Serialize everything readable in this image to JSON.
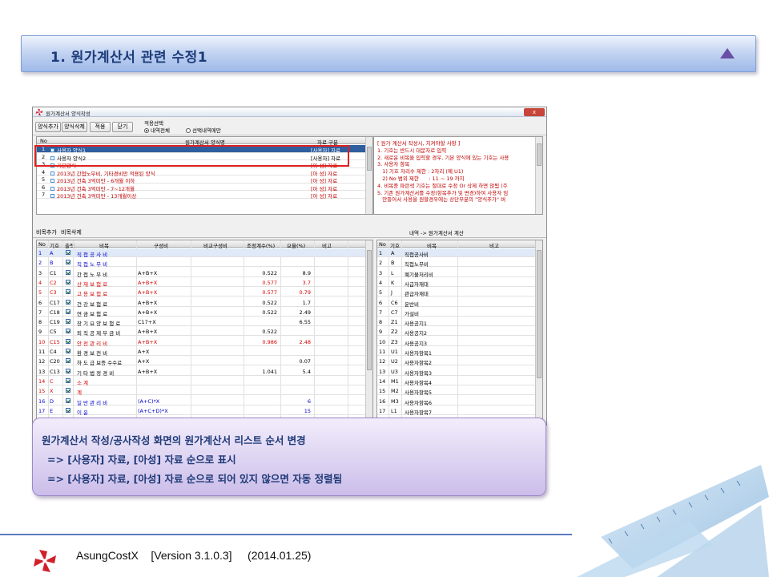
{
  "slide": {
    "title": "1. 원가계산서 관련 수정1",
    "callout": {
      "line1": "원가계산서 작성/공사작성 화면의 원가계산서 리스트 순서 변경",
      "line2": "=> [사용자] 자료, [아성] 자료 순으로 표시",
      "line3": "=> [사용자] 자료, [아성] 자료 순으로 되어 있지 않으면 자동 정렬됨"
    },
    "footer": {
      "product": "AsungCostX",
      "version": "[Version 3.1.0.3]",
      "date": "(2014.01.25)"
    }
  },
  "window": {
    "title": "원가계산서 양식작성",
    "close": "x"
  },
  "toolbar": {
    "add_form": "양식추가",
    "delete_form": "양식삭제",
    "apply": "적용",
    "close": "닫기",
    "apply_option_title": "적용선택",
    "radio_all": "내역전체",
    "radio_selected": "선택내역에만"
  },
  "form_grid": {
    "headers": {
      "no": "No",
      "name": "원가계산서 양식명",
      "kind": "자료 구분"
    },
    "rows": [
      {
        "no": "1",
        "name": "사용자 양식1",
        "kind": "[사용자] 자료"
      },
      {
        "no": "2",
        "name": "사용자 양식2",
        "kind": "[사용자] 자료"
      },
      {
        "no": "3",
        "name": "기본양식",
        "kind": "[아 성] 자료"
      },
      {
        "no": "4",
        "name": "2013년 간접노무비, 기타경비만 적용된 양식",
        "kind": "[아 성] 자료"
      },
      {
        "no": "5",
        "name": "2013년 건축 3억미만 - 6개월 이하",
        "kind": "[아 성] 자료"
      },
      {
        "no": "6",
        "name": "2013년 건축 3억미만 - 7~12개월",
        "kind": "[아 성] 자료"
      },
      {
        "no": "7",
        "name": "2013년 건축 3억미만 - 13개월이상",
        "kind": "[아 성] 자료"
      }
    ]
  },
  "notes": [
    "[ 원가 계산서 작성시, 지켜야할 사항 ]",
    "1. 기호는 반드시 대문자로 입력",
    "2. 새로운 비목을 입력할 경우, 기본 양식에 있는 기호는 사용",
    "3. 사용자 항목",
    "   1) 기호 자리수 제한 : 2자리 (예 U1)",
    "   2) No 범위 제한      : 11 ~ 19 까지",
    "4. 비목중 파란색 기호는 절대로 수정 Or 삭제 하면 않됨 (주",
    "5. 기존 원가계산서를 수정(항목추가 및 변경)하여 사용자 임",
    "   만들어서 사용을 원할경우에는 상단부분의 \"양식추가\" 버"
  ],
  "sub_toolbar": {
    "add_item": "비목추가",
    "delete_item": "비목삭제",
    "calc_caption": "내역 -> 원가계산서 계산"
  },
  "item_grid": {
    "headers": {
      "no": "No",
      "code": "기호",
      "print": "출력",
      "item": "비목",
      "composition": "구성비",
      "compare": "비교구성비",
      "adjust": "조정계수(%)",
      "rate": "요율(%)",
      "note": "비고"
    },
    "rows": [
      {
        "no": "1",
        "code": "A",
        "item": "직 접 공 사 비",
        "composition": "",
        "adjust": "",
        "rate": "",
        "color": "blue"
      },
      {
        "no": "2",
        "code": "B",
        "item": "직 접 노 무 비",
        "composition": "",
        "adjust": "",
        "rate": "",
        "color": "blue"
      },
      {
        "no": "3",
        "code": "C1",
        "item": "간 접 노 무 비",
        "composition": "A+B+X",
        "adjust": "0.522",
        "rate": "8.9",
        "color": "black"
      },
      {
        "no": "4",
        "code": "C2",
        "item": "산 재 보 험 료",
        "composition": "A+B+X",
        "adjust": "0.577",
        "rate": "3.7",
        "color": "red"
      },
      {
        "no": "5",
        "code": "C3",
        "item": "고 용 보 험 료",
        "composition": "A+B+X",
        "adjust": "0.577",
        "rate": "0.79",
        "color": "red"
      },
      {
        "no": "6",
        "code": "C17",
        "item": "건 강 보 험 료",
        "composition": "A+B+X",
        "adjust": "0.522",
        "rate": "1.7",
        "color": "black"
      },
      {
        "no": "7",
        "code": "C18",
        "item": "연 금 보 험 료",
        "composition": "A+B+X",
        "adjust": "0.522",
        "rate": "2.49",
        "color": "black"
      },
      {
        "no": "8",
        "code": "C19",
        "item": "장 기 요 양 보 험 료",
        "composition": "C17+X",
        "adjust": "",
        "rate": "6.55",
        "color": "black"
      },
      {
        "no": "9",
        "code": "C5",
        "item": "퇴 직 공 제 부 금 비",
        "composition": "A+B+X",
        "adjust": "0.522",
        "rate": "",
        "color": "black"
      },
      {
        "no": "10",
        "code": "C15",
        "item": "안 전 관 리 비",
        "composition": "A+B+X",
        "adjust": "0.986",
        "rate": "2.48",
        "color": "red"
      },
      {
        "no": "11",
        "code": "C4",
        "item": "환 경 보 전 비",
        "composition": "A+X",
        "adjust": "",
        "rate": "",
        "color": "black"
      },
      {
        "no": "12",
        "code": "C20",
        "item": "하 도 급 보증 수수료",
        "composition": "A+X",
        "adjust": "",
        "rate": "0.07",
        "color": "black"
      },
      {
        "no": "13",
        "code": "C13",
        "item": "기 타 법 정 경 비",
        "composition": "A+B+X",
        "adjust": "1.041",
        "rate": "5.4",
        "color": "black"
      },
      {
        "no": "14",
        "code": "C",
        "item": "소                계",
        "composition": "",
        "adjust": "",
        "rate": "",
        "color": "red"
      },
      {
        "no": "15",
        "code": "X",
        "item": "계",
        "composition": "",
        "adjust": "",
        "rate": "",
        "color": "red"
      },
      {
        "no": "16",
        "code": "D",
        "item": "일 반 관 리 비",
        "composition": "(A+C)*X",
        "adjust": "",
        "rate": "6",
        "color": "blue"
      },
      {
        "no": "17",
        "code": "E",
        "item": "이                윤",
        "composition": "(A+C+D)*X",
        "adjust": "",
        "rate": "15",
        "color": "blue"
      }
    ]
  },
  "calc_grid": {
    "headers": {
      "no": "No",
      "code": "기호",
      "item": "비목",
      "note": "비고"
    },
    "rows": [
      {
        "no": "1",
        "code": "A",
        "item": "직접공사비"
      },
      {
        "no": "2",
        "code": "B",
        "item": "직접노무비"
      },
      {
        "no": "3",
        "code": "L",
        "item": "폐기물처리비"
      },
      {
        "no": "4",
        "code": "K",
        "item": "사급자재대"
      },
      {
        "no": "5",
        "code": "J",
        "item": "관급자재대"
      },
      {
        "no": "6",
        "code": "C6",
        "item": "운반비"
      },
      {
        "no": "7",
        "code": "C7",
        "item": "가설비"
      },
      {
        "no": "8",
        "code": "Z1",
        "item": "사용공지1"
      },
      {
        "no": "9",
        "code": "Z2",
        "item": "사용공지2"
      },
      {
        "no": "10",
        "code": "Z3",
        "item": "사용공지3"
      },
      {
        "no": "11",
        "code": "U1",
        "item": "사용자항목1"
      },
      {
        "no": "12",
        "code": "U2",
        "item": "사용자항목2"
      },
      {
        "no": "13",
        "code": "U3",
        "item": "사용자항목3"
      },
      {
        "no": "14",
        "code": "M1",
        "item": "사용자항목4"
      },
      {
        "no": "15",
        "code": "M2",
        "item": "사용자항목5"
      },
      {
        "no": "16",
        "code": "M3",
        "item": "사용자항목6"
      },
      {
        "no": "17",
        "code": "L1",
        "item": "사용자항목7"
      }
    ]
  },
  "colors": {
    "title_text": "#1c3b7a",
    "selected_row": "#2f5e9e",
    "highlight_border": "#e02020",
    "red_text": "#d40000",
    "blue_text": "#0000cc"
  }
}
